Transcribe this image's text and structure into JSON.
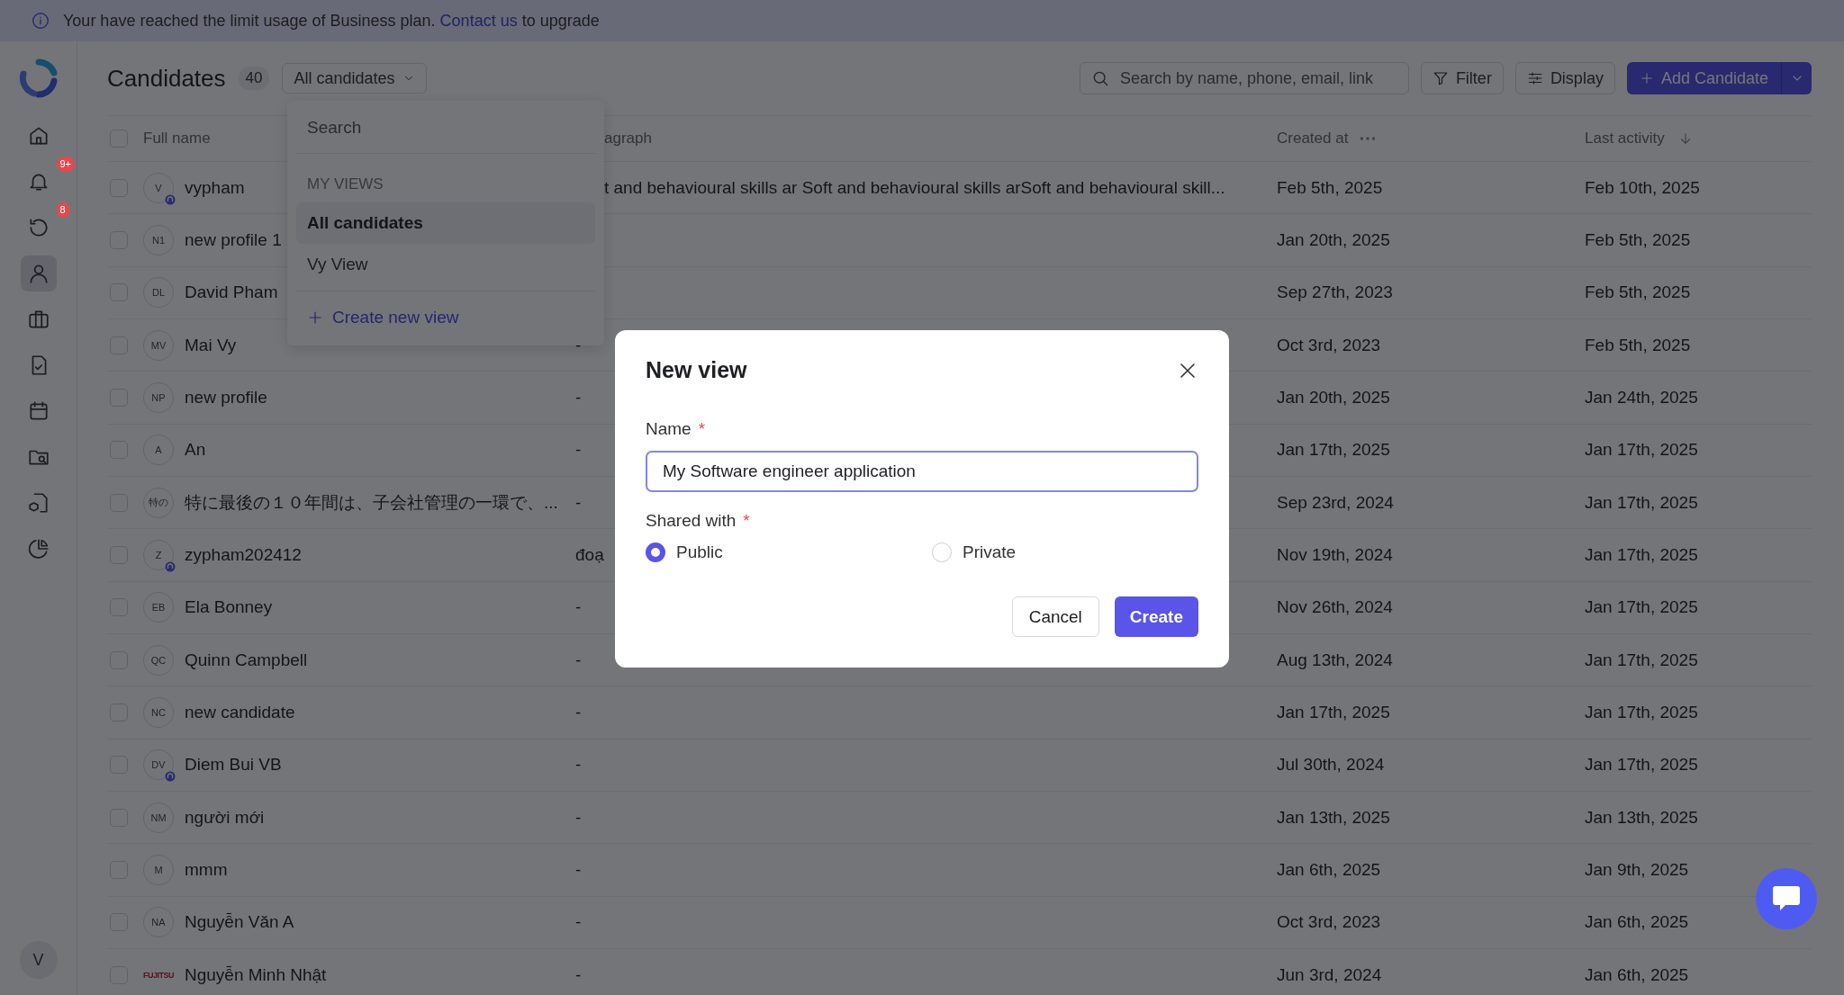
{
  "banner": {
    "text": "Your have reached the limit usage of Business plan.",
    "link": "Contact us",
    "suffix": "to upgrade"
  },
  "sidebar": {
    "items": [
      {
        "selected": false
      },
      {
        "selected": false,
        "badge": "9+"
      },
      {
        "selected": false,
        "badge": "8"
      },
      {
        "selected": true
      },
      {
        "selected": false
      },
      {
        "selected": false
      },
      {
        "selected": false
      },
      {
        "selected": false
      },
      {
        "selected": false
      },
      {
        "selected": false
      }
    ],
    "user_initial": "V"
  },
  "header": {
    "title": "Candidates",
    "count": "40",
    "view_select": "All candidates",
    "search_placeholder": "Search by name, phone, email, link",
    "filter": "Filter",
    "display": "Display",
    "add": "Add Candidate"
  },
  "table": {
    "select_all_checked": false,
    "columns": [
      {
        "label": "Full name",
        "kind": "name"
      },
      {
        "label": "agraph",
        "kind": "cut"
      },
      {
        "label": "Created at",
        "kind": "menu"
      },
      {
        "label": "Last activity",
        "kind": "sort"
      }
    ],
    "rows": [
      {
        "avatar": "V",
        "kind": "initials",
        "avatar_badge": true,
        "checked": false,
        "name": "vypham",
        "column_3": "t and behavioural skills ar Soft and behavioural skills arSoft and behavioural skill...",
        "column_3_cut": true,
        "created_at": "Feb 5th, 2025",
        "last_activity": "Feb 10th, 2025"
      },
      {
        "avatar": "N1",
        "kind": "initials",
        "avatar_badge": false,
        "checked": false,
        "name": "new profile 1",
        "created_at": "Jan 20th, 2025",
        "last_activity": "Feb 5th, 2025"
      },
      {
        "avatar": "DL",
        "kind": "initials",
        "avatar_badge": false,
        "checked": false,
        "name": "David Pham",
        "created_at": "Sep 27th, 2023",
        "last_activity": "Feb 5th, 2025"
      },
      {
        "avatar": "MV",
        "kind": "initials",
        "avatar_badge": false,
        "checked": false,
        "name": "Mai Vy",
        "column_3": "-",
        "created_at": "Oct 3rd, 2023",
        "last_activity": "Feb 5th, 2025"
      },
      {
        "avatar": "NP",
        "kind": "initials",
        "avatar_badge": false,
        "checked": false,
        "name": "new profile",
        "column_3": "-",
        "created_at": "Jan 20th, 2025",
        "last_activity": "Jan 24th, 2025"
      },
      {
        "avatar": "A",
        "kind": "initials",
        "avatar_badge": false,
        "checked": false,
        "name": "An",
        "column_3": "-",
        "created_at": "Jan 17th, 2025",
        "last_activity": "Jan 17th, 2025"
      },
      {
        "avatar": "特の",
        "kind": "initials",
        "avatar_badge": false,
        "checked": false,
        "name": "特に最後の１０年間は、子会社管理の一環で、...",
        "column_3": "-",
        "created_at": "Sep 23rd, 2024",
        "last_activity": "Jan 17th, 2025"
      },
      {
        "avatar": "Z",
        "kind": "initials",
        "avatar_badge": true,
        "checked": false,
        "name": "zypham202412",
        "column_3": "đoạ",
        "created_at": "Nov 19th, 2024",
        "last_activity": "Jan 17th, 2025"
      },
      {
        "avatar": "EB",
        "kind": "initials",
        "avatar_badge": false,
        "checked": false,
        "name": "Ela Bonney",
        "column_3": "-",
        "created_at": "Nov 26th, 2024",
        "last_activity": "Jan 17th, 2025"
      },
      {
        "avatar": "QC",
        "kind": "initials",
        "avatar_badge": false,
        "checked": false,
        "name": "Quinn Campbell",
        "column_3": "-",
        "created_at": "Aug 13th, 2024",
        "last_activity": "Jan 17th, 2025"
      },
      {
        "avatar": "NC",
        "kind": "initials",
        "avatar_badge": false,
        "checked": false,
        "name": "new candidate",
        "column_3": "-",
        "created_at": "Jan 17th, 2025",
        "last_activity": "Jan 17th, 2025"
      },
      {
        "avatar": "DV",
        "kind": "initials",
        "avatar_badge": true,
        "checked": false,
        "name": "Diem Bui VB",
        "column_3": "-",
        "created_at": "Jul 30th, 2024",
        "last_activity": "Jan 17th, 2025"
      },
      {
        "avatar": "NM",
        "kind": "initials",
        "avatar_badge": false,
        "checked": false,
        "name": "người mới",
        "column_3": "-",
        "created_at": "Jan 13th, 2025",
        "last_activity": "Jan 13th, 2025"
      },
      {
        "avatar": "M",
        "kind": "initials",
        "avatar_badge": false,
        "checked": false,
        "name": "mmm",
        "column_3": "-",
        "created_at": "Jan 6th, 2025",
        "last_activity": "Jan 9th, 2025"
      },
      {
        "avatar": "NA",
        "kind": "initials",
        "avatar_badge": false,
        "checked": false,
        "name": "Nguyễn Văn A",
        "column_3": "-",
        "created_at": "Oct 3rd, 2023",
        "last_activity": "Jan 6th, 2025"
      },
      {
        "avatar": "FUJITSU",
        "kind": "logo",
        "avatar_badge": false,
        "checked": false,
        "name": "Nguyễn Minh Nhật",
        "column_3": "-",
        "created_at": "Jun 3rd, 2024",
        "last_activity": "Jan 6th, 2025"
      }
    ]
  },
  "view_menu": {
    "search_placeholder": "Search",
    "section": "MY VIEWS",
    "views": [
      {
        "label": "All candidates",
        "selected": true
      },
      {
        "label": "Vy View",
        "selected": false
      }
    ],
    "create": "Create new view"
  },
  "modal": {
    "title": "New view",
    "name_label": "Name",
    "required_mark": "*",
    "name_value": "My Software engineer application",
    "shared_label": "Shared with",
    "options": [
      {
        "label": "Public",
        "selected": true
      },
      {
        "label": "Private",
        "selected": false
      }
    ],
    "cancel": "Cancel",
    "create": "Create"
  }
}
